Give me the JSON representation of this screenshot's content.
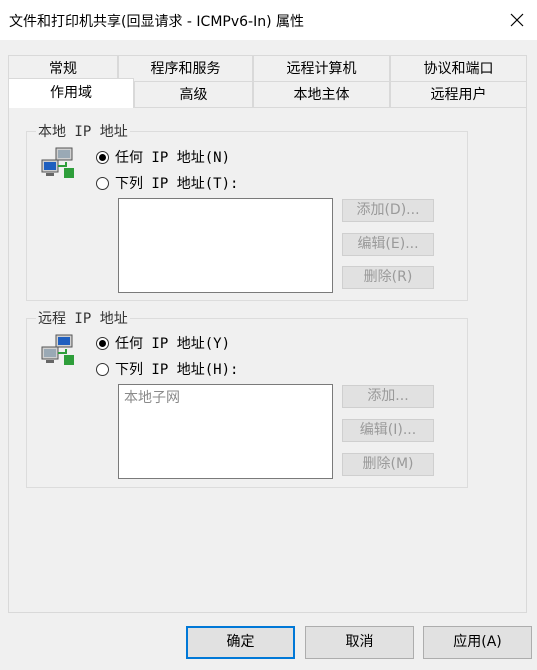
{
  "window": {
    "title": "文件和打印机共享(回显请求 - ICMPv6-In) 属性",
    "close_icon": "close-icon"
  },
  "tabs_row1": [
    {
      "label": "常规"
    },
    {
      "label": "程序和服务"
    },
    {
      "label": "远程计算机"
    },
    {
      "label": "协议和端口"
    }
  ],
  "tabs_row2": [
    {
      "label": "作用域",
      "selected": true
    },
    {
      "label": "高级"
    },
    {
      "label": "本地主体"
    },
    {
      "label": "远程用户"
    }
  ],
  "local_group": {
    "label": "本地 IP 地址",
    "radio_any": "任何 IP 地址(N)",
    "radio_list": "下列 IP 地址(T):",
    "selected": "any",
    "list_items": [],
    "add_label": "添加(D)...",
    "edit_label": "编辑(E)...",
    "delete_label": "删除(R)"
  },
  "remote_group": {
    "label": "远程 IP 地址",
    "radio_any": "任何 IP 地址(Y)",
    "radio_list": "下列 IP 地址(H):",
    "selected": "any",
    "list_items": [
      "本地子网"
    ],
    "add_label": "添加...",
    "edit_label": "编辑(I)...",
    "delete_label": "删除(M)"
  },
  "footer": {
    "ok_label": "确定",
    "cancel_label": "取消",
    "apply_label": "应用(A)"
  },
  "colors": {
    "accent": "#0078d7",
    "dialog_bg": "#f0f0f0"
  }
}
